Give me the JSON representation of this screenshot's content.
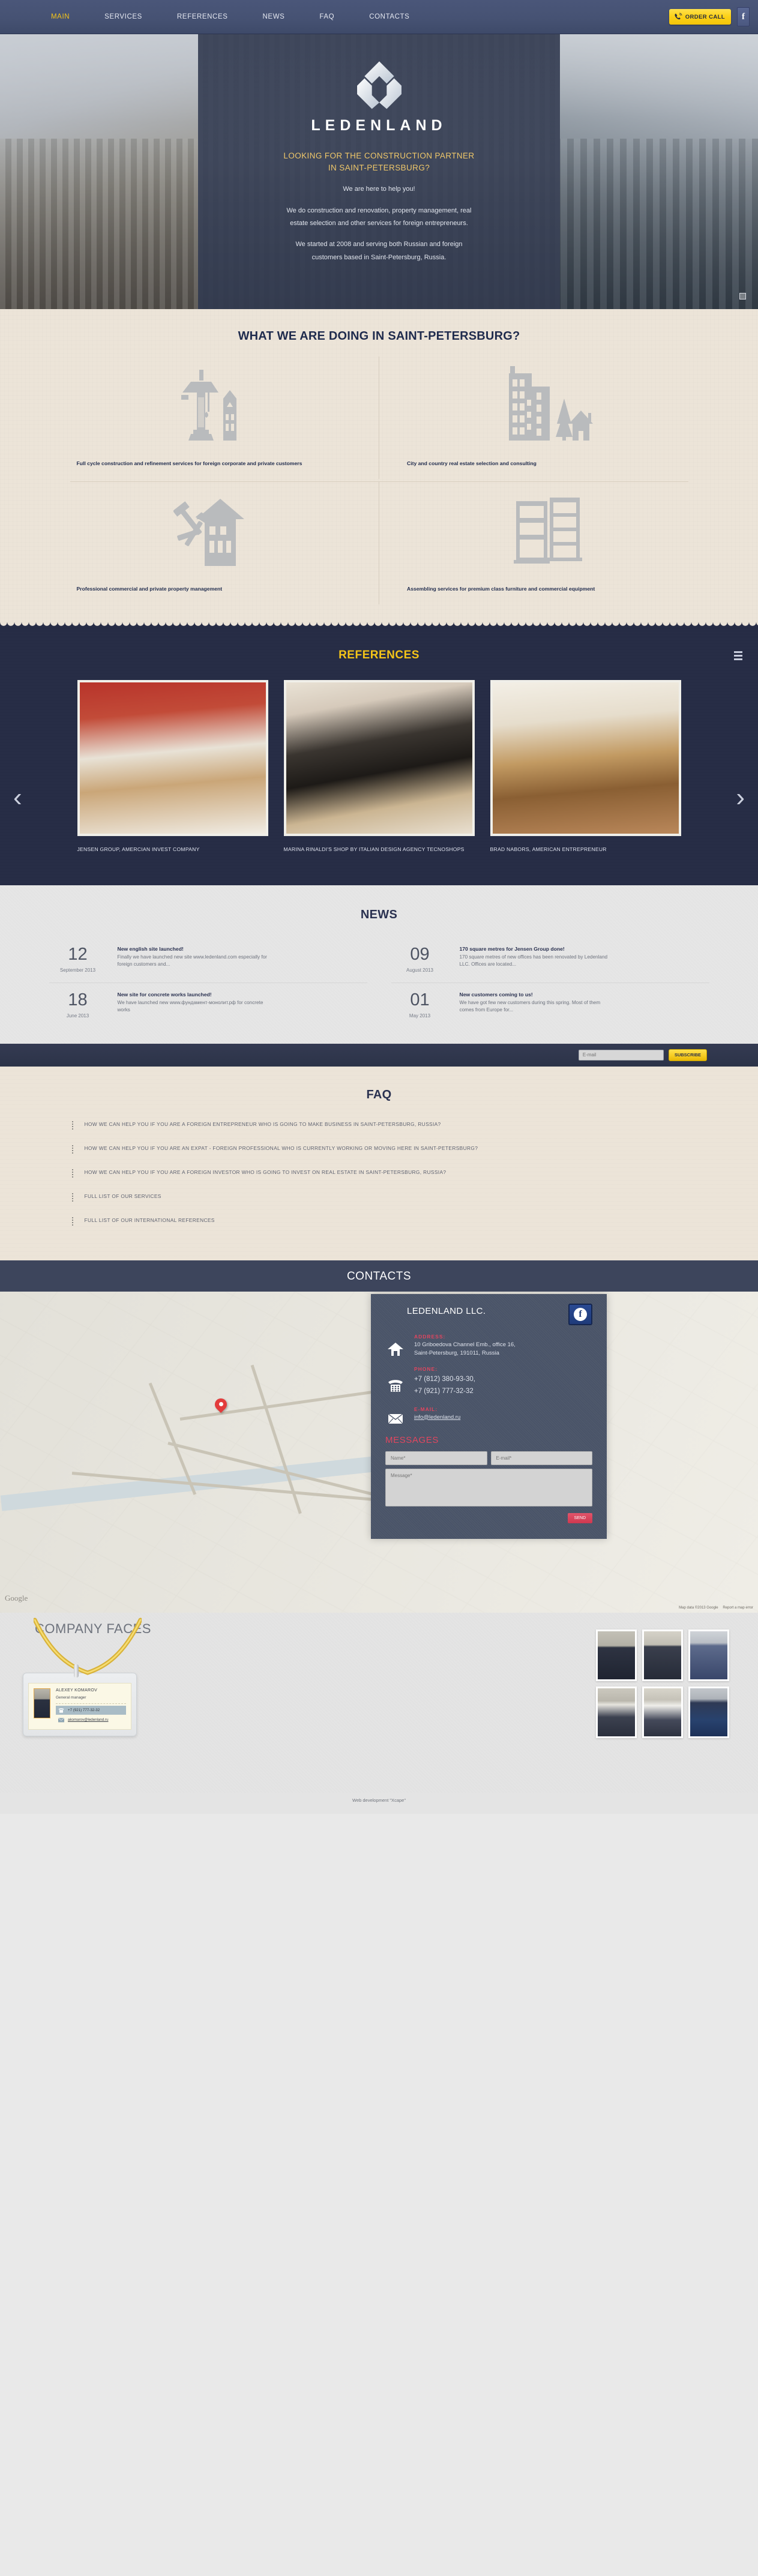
{
  "nav": {
    "items": [
      {
        "label": "MAIN",
        "active": true
      },
      {
        "label": "SERVICES",
        "active": false
      },
      {
        "label": "REFERENCES",
        "active": false
      },
      {
        "label": "NEWS",
        "active": false
      },
      {
        "label": "FAQ",
        "active": false
      },
      {
        "label": "CONTACTS",
        "active": false
      }
    ],
    "order_call_label": "ORDER CALL",
    "facebook_label": "f"
  },
  "hero": {
    "brand": "LEDENLAND",
    "headline": "LOOKING FOR THE CONSTRUCTION PARTNER IN SAINT-PETERSBURG?",
    "paragraph_1": "We are here to help you!",
    "paragraph_2": "We do construction and renovation, property management, real estate selection and other services for foreign entrepreneurs.",
    "paragraph_3": "We started at 2008 and serving both Russian and foreign customers based in Saint-Petersburg, Russia."
  },
  "services": {
    "title": "WHAT WE ARE DOING IN SAINT-PETERSBURG?",
    "items": [
      {
        "icon": "crane-house-icon",
        "text": "Full cycle construction and refinement services for foreign corporate and private customers"
      },
      {
        "icon": "city-country-buildings-icon",
        "text": "City and country real estate selection and consulting"
      },
      {
        "icon": "house-tools-icon",
        "text": "Professional commercial and private property management"
      },
      {
        "icon": "furniture-shelves-icon",
        "text": "Assembling services for premium class furniture and commercial equipment"
      }
    ]
  },
  "references": {
    "title": "REFERENCES",
    "list_icon": "list-view-icon",
    "prev_arrow": "‹",
    "next_arrow": "›",
    "items": [
      {
        "caption": "JENSEN GROUP, AMERCIAN INVEST COMPANY"
      },
      {
        "caption": "MARINA RINALDI'S SHOP BY ITALIAN DESIGN AGENCY TECNOSHOPS"
      },
      {
        "caption": "BRAD NABORS, AMERICAN ENTREPRENEUR"
      }
    ]
  },
  "news": {
    "title": "NEWS",
    "items": [
      {
        "day": "12",
        "month": "September 2013",
        "title": "New english site launched!",
        "desc": "Finally we have launched new site www.ledenland.com especially for foreign customers and..."
      },
      {
        "day": "09",
        "month": "August 2013",
        "title": "170 square metres for Jensen Group done!",
        "desc": "170 square metres of new offices has been renovated by Ledenland LLC. Offices are located..."
      },
      {
        "day": "18",
        "month": "June 2013",
        "title": "New site for concrete works launched!",
        "desc": "We have launched new www.фундамент-монолит.рф for concrete works"
      },
      {
        "day": "01",
        "month": "May 2013",
        "title": "New customers coming to us!",
        "desc": "We have got few new customers during this spring. Most of them comes from Europe for..."
      }
    ]
  },
  "subscribe": {
    "placeholder": "E-mail",
    "value": "",
    "button_label": "SUBSCRIBE"
  },
  "faq": {
    "title": "FAQ",
    "items": [
      "HOW WE CAN HELP YOU IF YOU ARE A FOREIGN ENTREPRENEUR WHO IS GOING TO MAKE BUSINESS IN SAINT-PETERSBURG, RUSSIA?",
      "HOW WE CAN HELP YOU IF YOU ARE AN EXPAT - FOREIGN PROFESSIONAL WHO IS CURRENTLY WORKING OR MOVING HERE IN SAINT-PETERSBURG?",
      "HOW WE CAN HELP YOU IF YOU ARE A FOREIGN INVESTOR WHO IS GOING TO INVEST ON REAL ESTATE IN SAINT-PETERSBURG, RUSSIA?",
      "FULL LIST OF OUR SERVICES",
      "FULL LIST OF OUR INTERNATIONAL REFERENCES"
    ]
  },
  "contacts": {
    "title": "CONTACTS",
    "company": "LEDENLAND LLC.",
    "facebook_label": "f",
    "address_label": "ADDRESS:",
    "address_line1": "10 Griboedova Channel Emb., office 16,",
    "address_line2": "Saint-Petersburg, 191011, Russia",
    "phone_label": "PHONE:",
    "phone_1": "+7 (812) 380-93-30,",
    "phone_2": "+7 (921) 777-32-32",
    "email_label": "E-MAIL:",
    "email": "info@ledenland.ru",
    "messages_title": "MESSAGES",
    "name_placeholder": "Name*",
    "email_placeholder": "E-mail*",
    "message_placeholder": "Message*",
    "send_label": "SEND",
    "map_logo": "Google",
    "map_credits": "Map data ©2013 Google",
    "map_report": "Report a map error"
  },
  "faces": {
    "title": "COMPANY FACES",
    "badge": {
      "name": "ALEXEY KOMAROV",
      "role": "General manager",
      "phone": "+7 (921) 777-32-32",
      "email": "akomarov@ledenland.ru"
    }
  },
  "footer": {
    "text": "Web development \"Xcape\""
  },
  "colors": {
    "nav_bg": "#465273",
    "accent_yellow": "#f5c518",
    "dark_blue": "#262c45",
    "beige": "#ece4d8",
    "red": "#e0465f"
  }
}
